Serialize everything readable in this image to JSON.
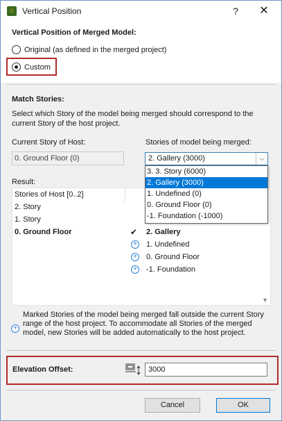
{
  "window": {
    "title": "Vertical Position",
    "help_label": "?",
    "close_label": "✕"
  },
  "vertical_position": {
    "heading": "Vertical Position of Merged Model:",
    "option_original": "Original (as defined in the merged project)",
    "option_custom": "Custom",
    "selected": "custom"
  },
  "match_stories": {
    "heading": "Match Stories:",
    "description": "Select which Story of the model being merged should correspond to the current Story of the host project.",
    "host_label": "Current Story of Host:",
    "host_value": "0. Ground Floor (0)",
    "merged_label": "Stories of model being merged:",
    "merged_selected": "2. Gallery (3000)",
    "merged_options": [
      "3. 3. Story (6000)",
      "2. Gallery (3000)",
      "1. Undefined (0)",
      "0. Ground Floor (0)",
      "-1. Foundation (-1000)"
    ],
    "merged_selected_index": 1
  },
  "result": {
    "label": "Result:",
    "host_rows": [
      {
        "text": "Stories of Host [0..2]",
        "bold": false
      },
      {
        "text": "2. Story",
        "bold": false
      },
      {
        "text": "1. Story",
        "bold": false
      },
      {
        "text": "0. Ground Floor",
        "bold": true
      }
    ],
    "merged_rows": [
      {
        "marker": "check",
        "text": "2. Gallery",
        "bold": true
      },
      {
        "marker": "plus",
        "text": "1. Undefined",
        "bold": false
      },
      {
        "marker": "plus",
        "text": "0. Ground Floor",
        "bold": false
      },
      {
        "marker": "plus",
        "text": "-1. Foundation",
        "bold": false
      }
    ]
  },
  "info": {
    "text": "Marked Stories of the model being merged fall outside the current Story range of the host project. To accommodate all Stories of the merged model, new Stories will be added automatically to the host project."
  },
  "elevation": {
    "label": "Elevation Offset:",
    "value": "3000",
    "icon": "elevation-offset-icon"
  },
  "buttons": {
    "cancel": "Cancel",
    "ok": "OK"
  },
  "colors": {
    "highlight_box": "#b22a2a",
    "selection": "#0078d7",
    "plus_icon": "#2a82d6"
  }
}
